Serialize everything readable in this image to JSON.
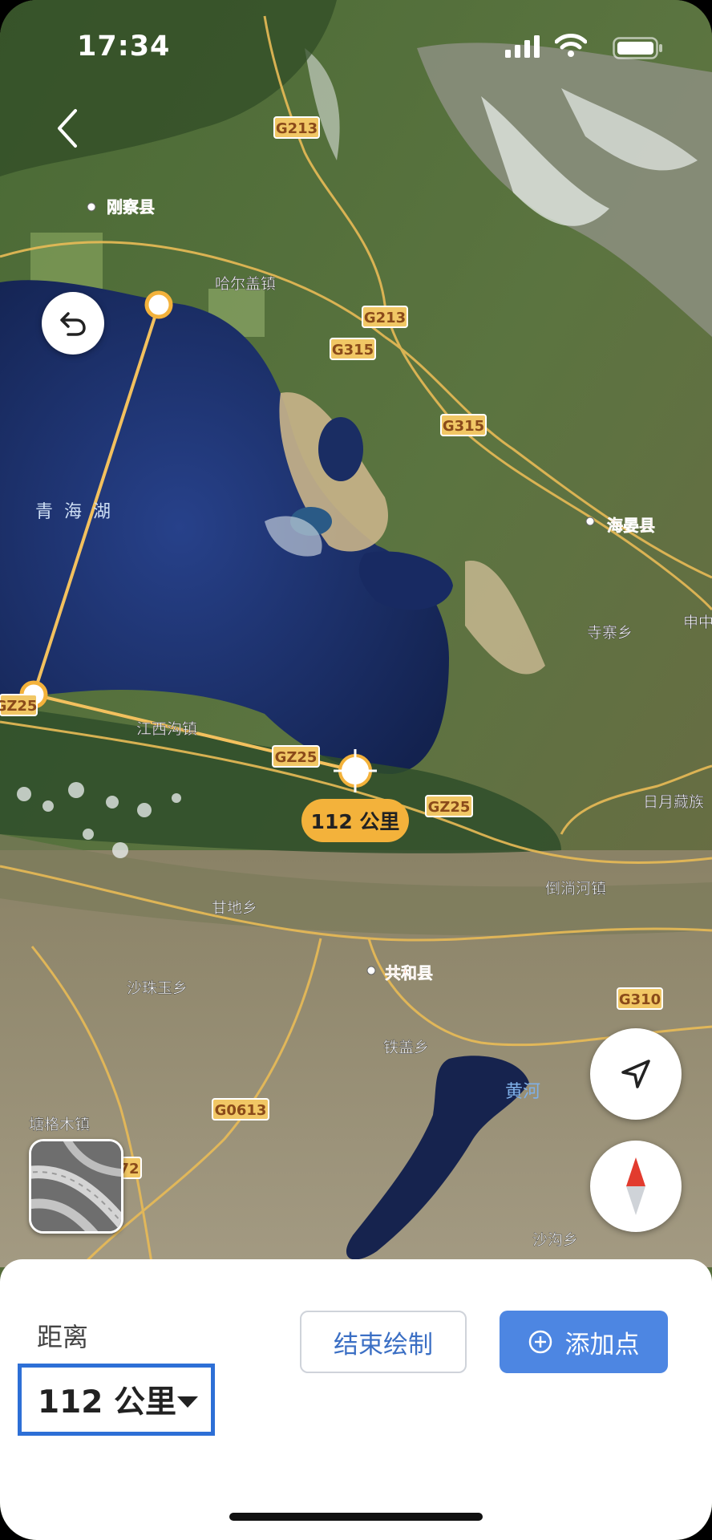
{
  "status_bar": {
    "time": "17:34"
  },
  "map": {
    "place_labels": [
      "刚察县",
      "哈尔盖镇",
      "青海湖",
      "海晏县",
      "寺寨乡",
      "申中",
      "江西沟镇",
      "日月藏族",
      "倒淌河镇",
      "甘地乡",
      "共和县",
      "沙珠玉乡",
      "铁盖乡",
      "黄河",
      "塘格木镇",
      "沙沟乡"
    ],
    "road_labels": [
      "G213",
      "G213",
      "G315",
      "G315",
      "GZ25",
      "GZ25",
      "GZ25",
      "G310",
      "G0613",
      "72"
    ],
    "distance_badge": "112 公里"
  },
  "panel": {
    "distance_label": "距离",
    "distance_value": "112 公里",
    "end_draw_label": "结束绘制",
    "add_point_label": "添加点"
  },
  "icons": {
    "back": "chevron-left-icon",
    "undo": "undo-icon",
    "locate": "navigation-arrow-icon",
    "compass": "compass-icon",
    "layer": "map-layer-icon",
    "add": "plus-circle-icon"
  },
  "colors": {
    "accent": "#4d86e2",
    "highlight": "#2d6fd6",
    "route": "#f3c15e",
    "badge": "#f3b23b",
    "place_label": "#e06a38",
    "road_label_bg": "#f1c765"
  }
}
